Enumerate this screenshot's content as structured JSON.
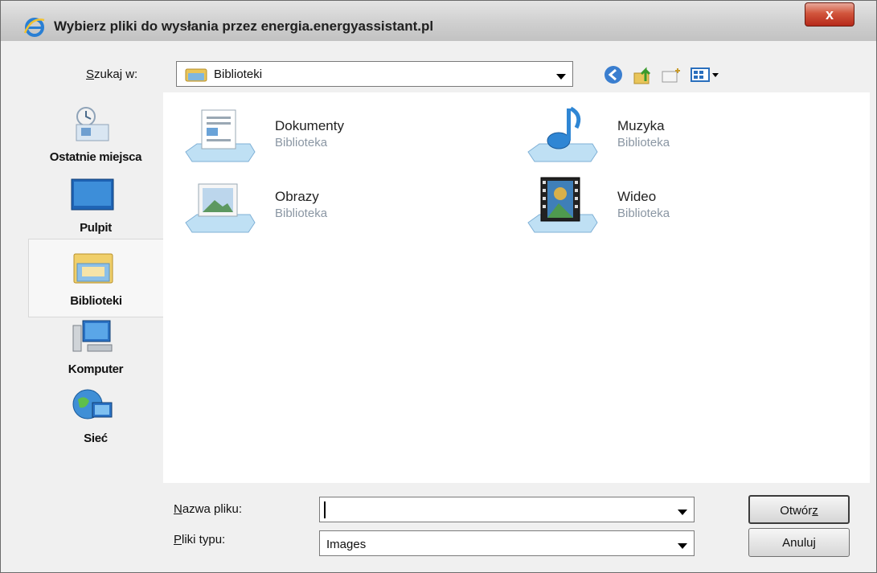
{
  "window": {
    "title": "Wybierz pliki do wysłania przez energia.energyassistant.pl",
    "close_label": "x"
  },
  "lookin": {
    "label_u": "S",
    "label_rest": "zukaj w:",
    "value": "Biblioteki"
  },
  "places": [
    {
      "label": "Ostatnie miejsca",
      "icon": "recent-places-icon"
    },
    {
      "label": "Pulpit",
      "icon": "desktop-icon"
    },
    {
      "label": "Biblioteki",
      "icon": "libraries-icon",
      "selected": true
    },
    {
      "label": "Komputer",
      "icon": "computer-icon"
    },
    {
      "label": "Sieć",
      "icon": "network-icon"
    }
  ],
  "items": [
    {
      "name": "Dokumenty",
      "type": "Biblioteka",
      "icon": "documents-library-icon"
    },
    {
      "name": "Muzyka",
      "type": "Biblioteka",
      "icon": "music-library-icon"
    },
    {
      "name": "Obrazy",
      "type": "Biblioteka",
      "icon": "pictures-library-icon"
    },
    {
      "name": "Wideo",
      "type": "Biblioteka",
      "icon": "video-library-icon"
    }
  ],
  "filename": {
    "label_u": "N",
    "label_rest": "azwa pliku:",
    "value": ""
  },
  "filetype": {
    "label_u": "P",
    "label_rest": "liki typu:",
    "value": "Images"
  },
  "buttons": {
    "open_main": "Otwór",
    "open_u": "z",
    "cancel": "Anuluj"
  },
  "colors": {
    "close_button": "#c8402a",
    "secondary_text": "#8a96a3",
    "selection_bg": "#f7f7f7"
  }
}
